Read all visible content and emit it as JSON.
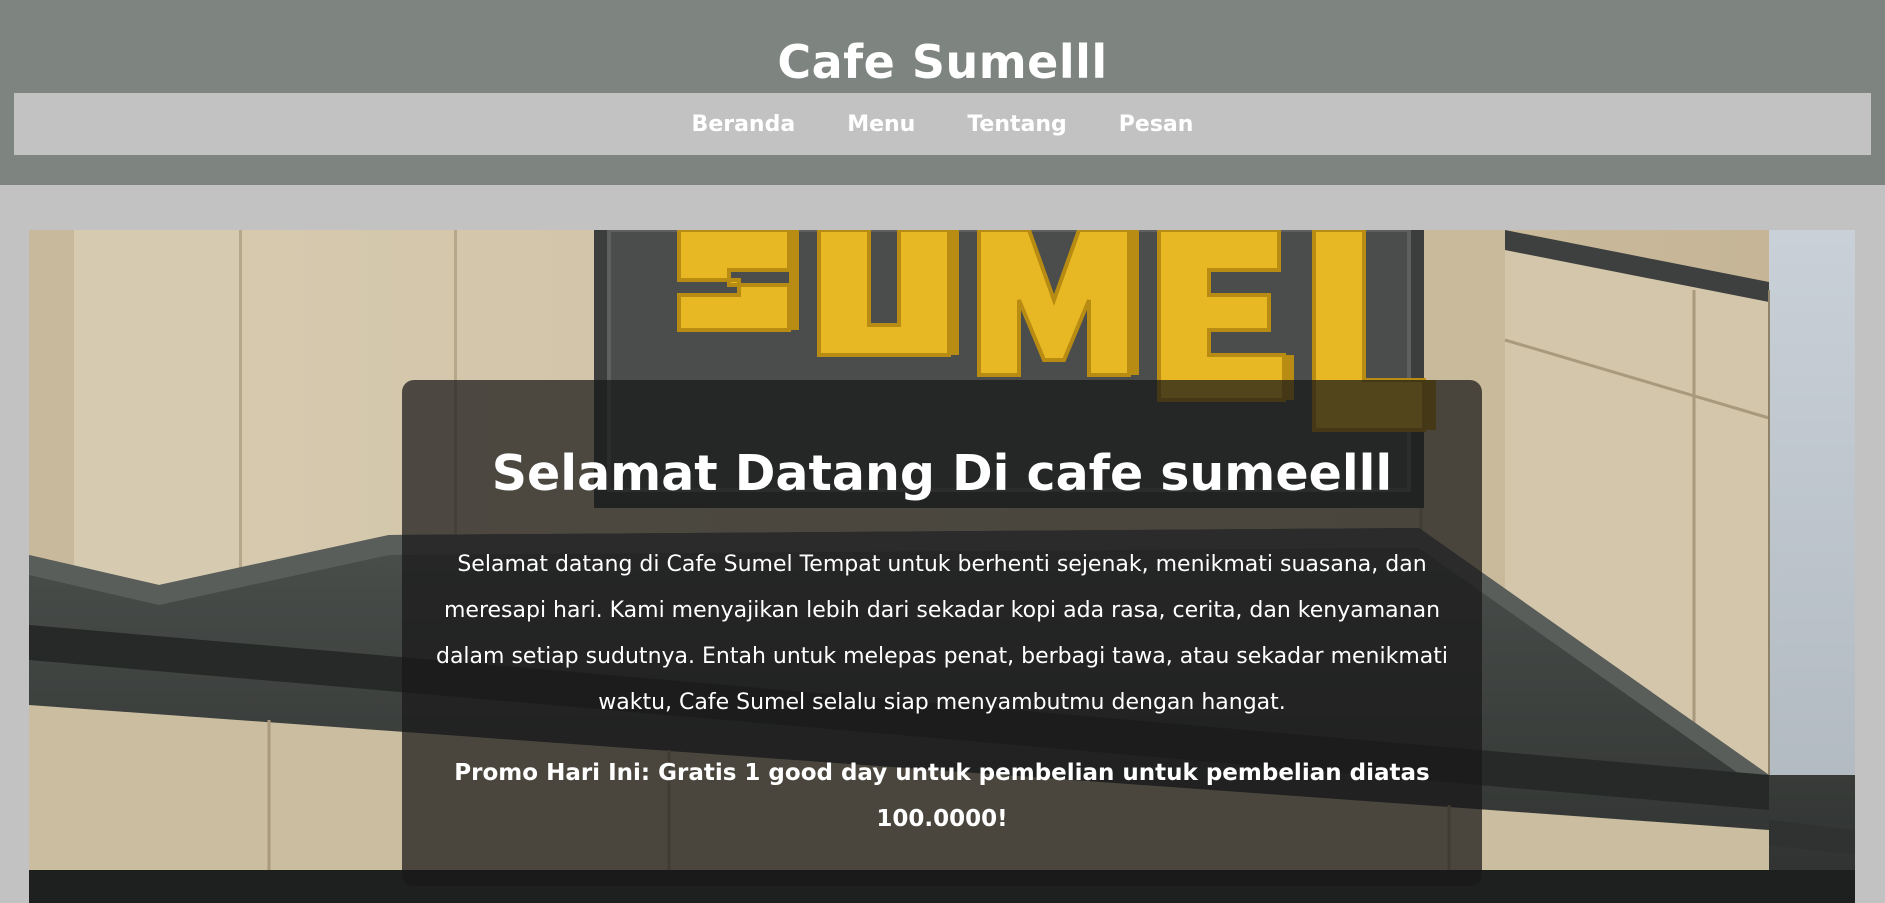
{
  "header": {
    "site_title": "Cafe Sumelll",
    "nav": [
      {
        "label": "Beranda"
      },
      {
        "label": "Menu"
      },
      {
        "label": "Tentang"
      },
      {
        "label": "Pesan"
      }
    ]
  },
  "hero": {
    "sign_text": "SUMEL",
    "title": "Selamat Datang Di cafe sumeelll",
    "description": "Selamat datang di Cafe Sumel Tempat untuk berhenti sejenak, menikmati suasana, dan meresapi hari. Kami menyajikan lebih dari sekadar kopi ada rasa, cerita, dan kenyamanan dalam setiap sudutnya. Entah untuk melepas penat, berbagi tawa, atau sekadar menikmati waktu, Cafe Sumel selalu siap menyambutmu dengan hangat.",
    "promo": "Promo Hari Ini: Gratis 1 good day untuk pembelian untuk pembelian diatas 100.0000!"
  },
  "colors": {
    "header_bg": "#7e847f",
    "nav_bg": "#c2c2c2",
    "page_bg": "#c2c2c2",
    "sign_letters": "#e8b824",
    "card_overlay": "rgba(23,23,23,0.72)"
  }
}
